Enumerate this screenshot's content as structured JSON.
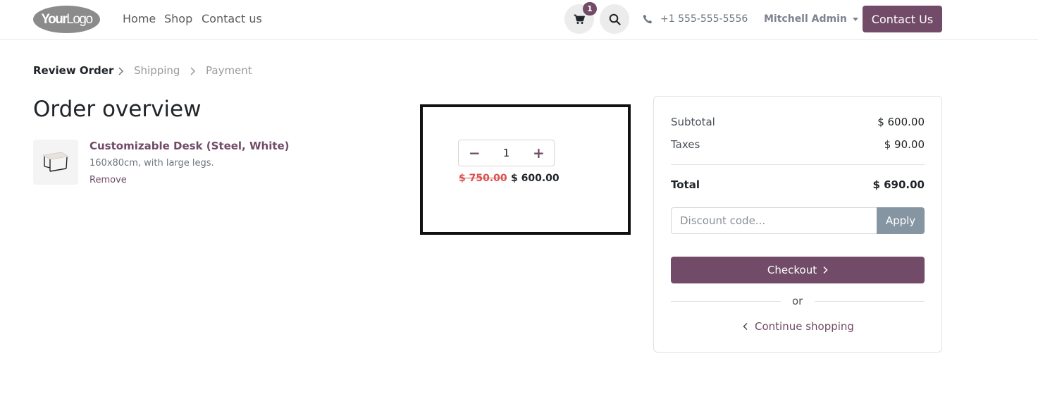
{
  "header": {
    "logo_text_bold": "Your",
    "logo_text": "Logo",
    "nav": [
      "Home",
      "Shop",
      "Contact us"
    ],
    "cart_count": "1",
    "phone": "+1 555-555-5556",
    "user": "Mitchell Admin",
    "contact_button": "Contact Us"
  },
  "steps": [
    "Review Order",
    "Shipping",
    "Payment"
  ],
  "page_title": "Order overview",
  "product": {
    "name": "Customizable Desk (Steel, White)",
    "description": "160x80cm, with large legs.",
    "remove_label": "Remove",
    "quantity": "1",
    "old_price": "$ 750.00",
    "price": "$ 600.00"
  },
  "summary": {
    "subtotal_label": "Subtotal",
    "subtotal_value": "$ 600.00",
    "taxes_label": "Taxes",
    "taxes_value": "$ 90.00",
    "total_label": "Total",
    "total_value": "$ 690.00",
    "discount_placeholder": "Discount code...",
    "apply_label": "Apply",
    "checkout_label": "Checkout",
    "or_label": "or",
    "continue_label": "Continue shopping"
  },
  "colors": {
    "brand": "#714b67",
    "apply": "#8595a2",
    "strike_price": "#d9534f"
  }
}
